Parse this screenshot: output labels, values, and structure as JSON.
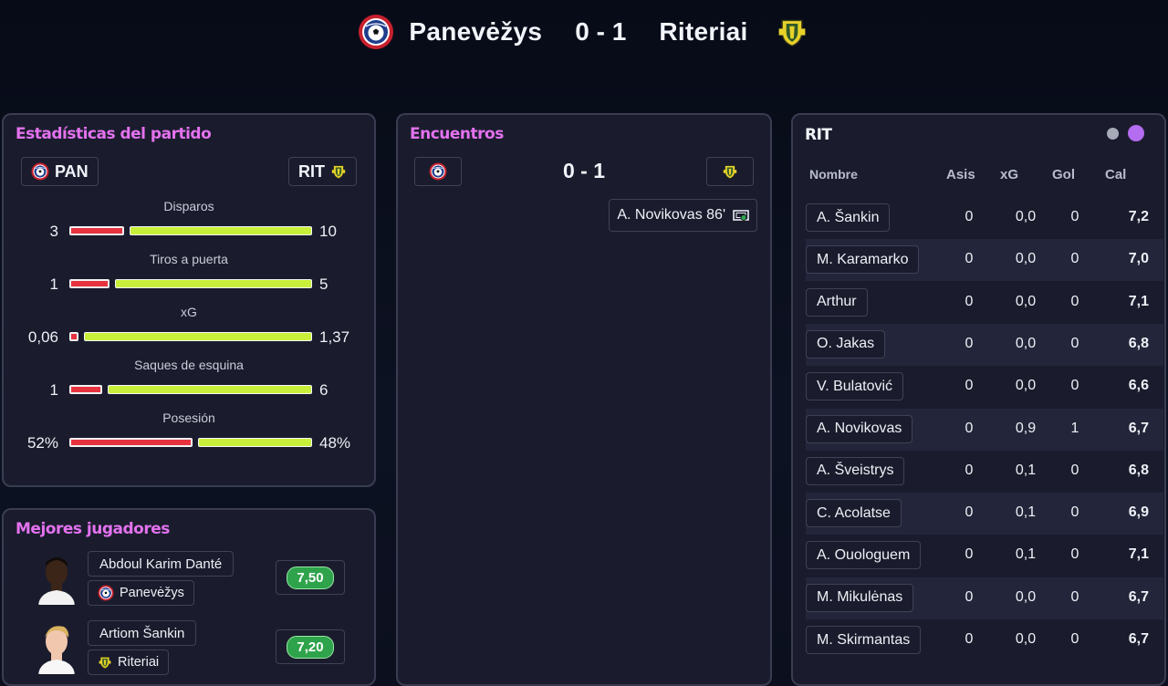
{
  "header": {
    "home_team": "Panevėžys",
    "score": "0 - 1",
    "away_team": "Riteriai",
    "home_crest_icon": "panevezys-crest-icon",
    "away_crest_icon": "riteriai-crest-icon"
  },
  "stats": {
    "title": "Estadísticas del partido",
    "home_abbr": "PAN",
    "away_abbr": "RIT",
    "rows": [
      {
        "label": "Disparos",
        "home": "3",
        "away": "10",
        "home_frac": 0.23,
        "away_frac": 0.77
      },
      {
        "label": "Tiros a puerta",
        "home": "1",
        "away": "5",
        "home_frac": 0.17,
        "away_frac": 0.83
      },
      {
        "label": "xG",
        "home": "0,06",
        "away": "1,37",
        "home_frac": 0.04,
        "away_frac": 0.96
      },
      {
        "label": "Saques de esquina",
        "home": "1",
        "away": "6",
        "home_frac": 0.14,
        "away_frac": 0.86
      },
      {
        "label": "Posesión",
        "home": "52%",
        "away": "48%",
        "home_frac": 0.52,
        "away_frac": 0.48
      }
    ],
    "colors": {
      "home": "#e6333f",
      "away": "#c8f03a"
    }
  },
  "best_players": {
    "title": "Mejores jugadores",
    "players": [
      {
        "name": "Abdoul Karim Danté",
        "team": "Panevėžys",
        "rating": "7,50"
      },
      {
        "name": "Artiom Šankin",
        "team": "Riteriai",
        "rating": "7,20"
      }
    ]
  },
  "encounters": {
    "title": "Encuentros",
    "score": "0 - 1",
    "goal": "A. Novikovas 86'"
  },
  "rit_table": {
    "title": "RIT",
    "columns": {
      "name": "Nombre",
      "assists": "Asis",
      "xg": "xG",
      "goals": "Gol",
      "rating": "Cal"
    },
    "rows": [
      {
        "name": "A. Šankin",
        "assists": "0",
        "xg": "0,0",
        "goals": "0",
        "rating": "7,2"
      },
      {
        "name": "M. Karamarko",
        "assists": "0",
        "xg": "0,0",
        "goals": "0",
        "rating": "7,0"
      },
      {
        "name": "Arthur",
        "assists": "0",
        "xg": "0,0",
        "goals": "0",
        "rating": "7,1"
      },
      {
        "name": "O. Jakas",
        "assists": "0",
        "xg": "0,0",
        "goals": "0",
        "rating": "6,8"
      },
      {
        "name": "V. Bulatović",
        "assists": "0",
        "xg": "0,0",
        "goals": "0",
        "rating": "6,6"
      },
      {
        "name": "A. Novikovas",
        "assists": "0",
        "xg": "0,9",
        "goals": "1",
        "rating": "6,7"
      },
      {
        "name": "A. Šveistrys",
        "assists": "0",
        "xg": "0,1",
        "goals": "0",
        "rating": "6,8"
      },
      {
        "name": "C. Acolatse",
        "assists": "0",
        "xg": "0,1",
        "goals": "0",
        "rating": "6,9"
      },
      {
        "name": "A. Ouologuem",
        "assists": "0",
        "xg": "0,1",
        "goals": "0",
        "rating": "7,1"
      },
      {
        "name": "M. Mikulėnas",
        "assists": "0",
        "xg": "0,0",
        "goals": "0",
        "rating": "6,7"
      },
      {
        "name": "M. Skirmantas",
        "assists": "0",
        "xg": "0,0",
        "goals": "0",
        "rating": "6,7"
      }
    ],
    "pager_colors": {
      "inactive": "#a7abb8",
      "active": "#b46cf0"
    }
  }
}
